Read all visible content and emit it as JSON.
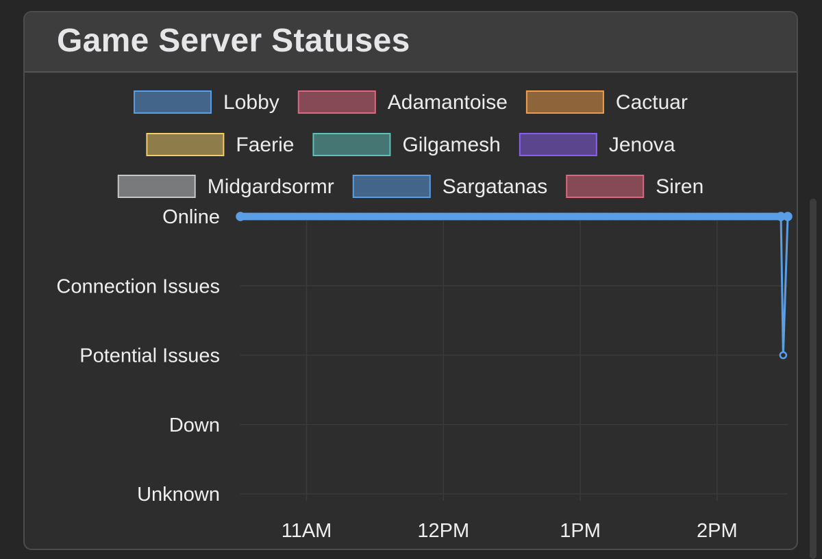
{
  "panel": {
    "title": "Game Server Statuses"
  },
  "chart_data": {
    "type": "line",
    "title": "Game Server Statuses",
    "legend_position": "top",
    "grid": true,
    "y_categories": [
      "Unknown",
      "Down",
      "Potential Issues",
      "Connection Issues",
      "Online"
    ],
    "x_ticks": [
      "11AM",
      "12PM",
      "1PM",
      "2PM"
    ],
    "xlim": [
      "10:31",
      "14:31"
    ],
    "series": [
      {
        "name": "Lobby",
        "color": "#5a9ee6",
        "visible": true,
        "points": [
          [
            "10:31",
            "Online"
          ],
          [
            "14:28",
            "Online"
          ],
          [
            "14:29",
            "Potential Issues"
          ],
          [
            "14:31",
            "Online"
          ]
        ]
      },
      {
        "name": "Adamantoise",
        "color": "#e0667f",
        "visible": false,
        "points": []
      },
      {
        "name": "Cactuar",
        "color": "#ef9d4a",
        "visible": false,
        "points": []
      },
      {
        "name": "Faerie",
        "color": "#f0cd67",
        "visible": false,
        "points": []
      },
      {
        "name": "Gilgamesh",
        "color": "#5dc0bc",
        "visible": false,
        "points": []
      },
      {
        "name": "Jenova",
        "color": "#8a5ff0",
        "visible": false,
        "points": []
      },
      {
        "name": "Midgardsormr",
        "color": "#c5c7cb",
        "visible": false,
        "points": []
      },
      {
        "name": "Sargatanas",
        "color": "#5a9ee6",
        "visible": false,
        "points": []
      },
      {
        "name": "Siren",
        "color": "#e0667f",
        "visible": false,
        "points": []
      }
    ]
  }
}
